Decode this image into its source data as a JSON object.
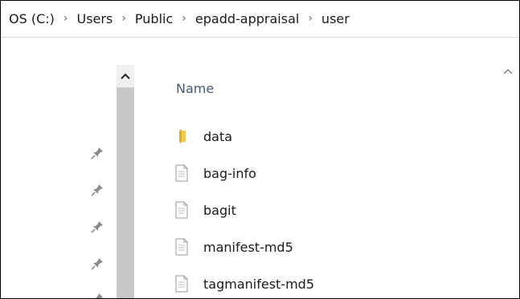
{
  "breadcrumb": [
    "OS (C:)",
    "Users",
    "Public",
    "epadd-appraisal",
    "user"
  ],
  "breadcrumb_separator": "›",
  "header": {
    "name_label": "Name"
  },
  "files": [
    {
      "name": "data",
      "icon": "folder-icon"
    },
    {
      "name": "bag-info",
      "icon": "document-icon"
    },
    {
      "name": "bagit",
      "icon": "document-icon"
    },
    {
      "name": "manifest-md5",
      "icon": "document-icon"
    },
    {
      "name": "tagmanifest-md5",
      "icon": "document-icon"
    }
  ],
  "colors": {
    "folder": "#f2c94c",
    "header_text": "#4a5a75",
    "scrollbar": "#c8c8c8"
  }
}
